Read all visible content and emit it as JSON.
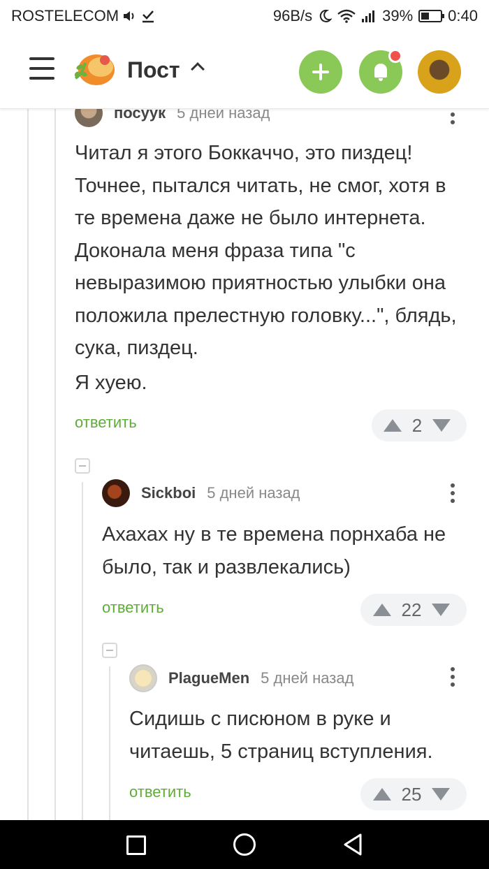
{
  "status_bar": {
    "carrier": "ROSTELECOM",
    "net_speed": "96B/s",
    "battery": "39%",
    "time": "0:40"
  },
  "header": {
    "title": "Пост",
    "accent_color": "#8ac858",
    "icons": [
      "menu-icon",
      "logo-icon",
      "chevron-up-icon",
      "add-icon",
      "bell-icon",
      "avatar"
    ]
  },
  "comments": [
    {
      "user": "посуук",
      "time": "5 дней назад",
      "text": "Читал я этого Боккаччо, это пиздец! Точнее, пытался читать, не смог, хотя в те времена даже не было интернета. Доконала меня фраза типа \"с невыразимою приятностью улыбки она положила прелестную головку...\", блядь, сука, пиздец.",
      "text2": "Я хуею.",
      "reply": "ответить",
      "rating": "2"
    },
    {
      "user": "Sickboi",
      "time": "5 дней назад",
      "text": "Ахахах ну в те времена порнхаба не было, так и развлекались)",
      "reply": "ответить",
      "rating": "22"
    },
    {
      "user": "PlagueMen",
      "time": "5 дней назад",
      "text": "Сидишь с писюном в руке и читаешь, 5 страниц вступления.",
      "reply": "ответить",
      "rating": "25"
    }
  ]
}
